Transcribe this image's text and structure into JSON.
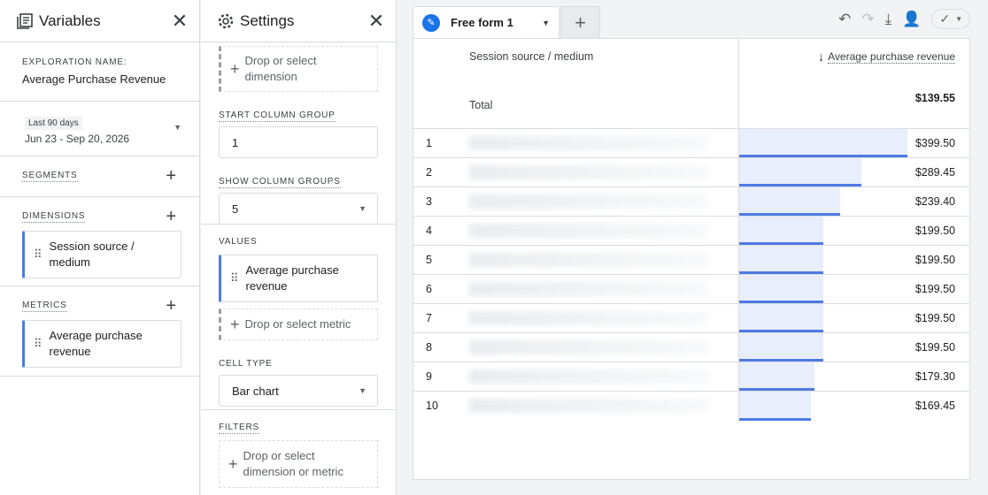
{
  "variables": {
    "title": "Variables",
    "exploration_label": "EXPLORATION NAME:",
    "exploration_name": "Average Purchase Revenue",
    "date_chip": "Last 90 days",
    "date_range": "Jun 23 - Sep 20, 2026",
    "segments_label": "SEGMENTS",
    "dimensions_label": "DIMENSIONS",
    "dimension_item": "Session source / medium",
    "metrics_label": "METRICS",
    "metric_item": "Average purchase revenue"
  },
  "settings": {
    "title": "Settings",
    "drop_dimension": "Drop or select dimension",
    "start_col_label": "START COLUMN GROUP",
    "start_col_value": "1",
    "show_col_label": "SHOW COLUMN GROUPS",
    "show_col_value": "5",
    "values_label": "VALUES",
    "value_item": "Average purchase revenue",
    "drop_metric": "Drop or select metric",
    "cell_type_label": "CELL TYPE",
    "cell_type_value": "Bar chart",
    "filters_label": "FILTERS",
    "drop_filter": "Drop or select dimension or metric"
  },
  "canvas": {
    "tab_name": "Free form 1",
    "icons": [
      "undo-icon",
      "redo-icon",
      "download-icon",
      "share-user-icon",
      "check-circle-icon"
    ],
    "table": {
      "dimension_header": "Session source / medium",
      "metric_header": "Average purchase revenue",
      "total_label": "Total",
      "total_value": "$139.55",
      "rows": [
        {
          "n": "1",
          "value": "$399.50",
          "fraction": 1.0
        },
        {
          "n": "2",
          "value": "$289.45",
          "fraction": 0.7245
        },
        {
          "n": "3",
          "value": "$239.40",
          "fraction": 0.5992
        },
        {
          "n": "4",
          "value": "$199.50",
          "fraction": 0.4994
        },
        {
          "n": "5",
          "value": "$199.50",
          "fraction": 0.4994
        },
        {
          "n": "6",
          "value": "$199.50",
          "fraction": 0.4994
        },
        {
          "n": "7",
          "value": "$199.50",
          "fraction": 0.4994
        },
        {
          "n": "8",
          "value": "$199.50",
          "fraction": 0.4994
        },
        {
          "n": "9",
          "value": "$179.30",
          "fraction": 0.4488
        },
        {
          "n": "10",
          "value": "$169.45",
          "fraction": 0.4242
        }
      ]
    }
  },
  "colors": {
    "accent": "#4e7ae4",
    "bar_fill": "#e8eefb",
    "pen_blue": "#1a73e8"
  }
}
